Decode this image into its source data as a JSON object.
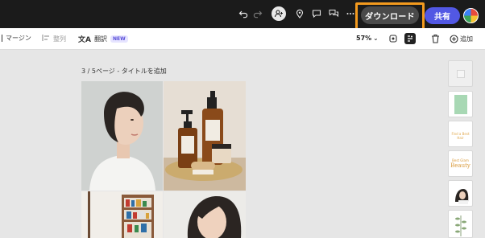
{
  "topbar": {
    "download_label": "ダウンロード",
    "share_label": "共有",
    "icons": [
      "undo-icon",
      "redo-icon",
      "add-person-icon",
      "location-pin-icon",
      "comment-icon",
      "comments-icon",
      "more-icon"
    ],
    "accent_color": "#5258e4",
    "highlight_color": "#f39a1e"
  },
  "toolbar": {
    "margin_label": "マージン",
    "arrange_label": "整列",
    "translate_label": "翻訳",
    "new_badge": "NEW",
    "zoom": "57%",
    "add_label": "追加"
  },
  "canvas": {
    "page_label": "3 / 5ページ - タイトルを追加"
  },
  "thumbnails": {
    "items": [
      {
        "text": ""
      },
      {
        "text": ""
      },
      {
        "text": "Find a Best Hair"
      },
      {
        "text_small": "Best Glam",
        "text_big": "Beauty"
      },
      {
        "text": ""
      },
      {
        "text": ""
      }
    ]
  }
}
